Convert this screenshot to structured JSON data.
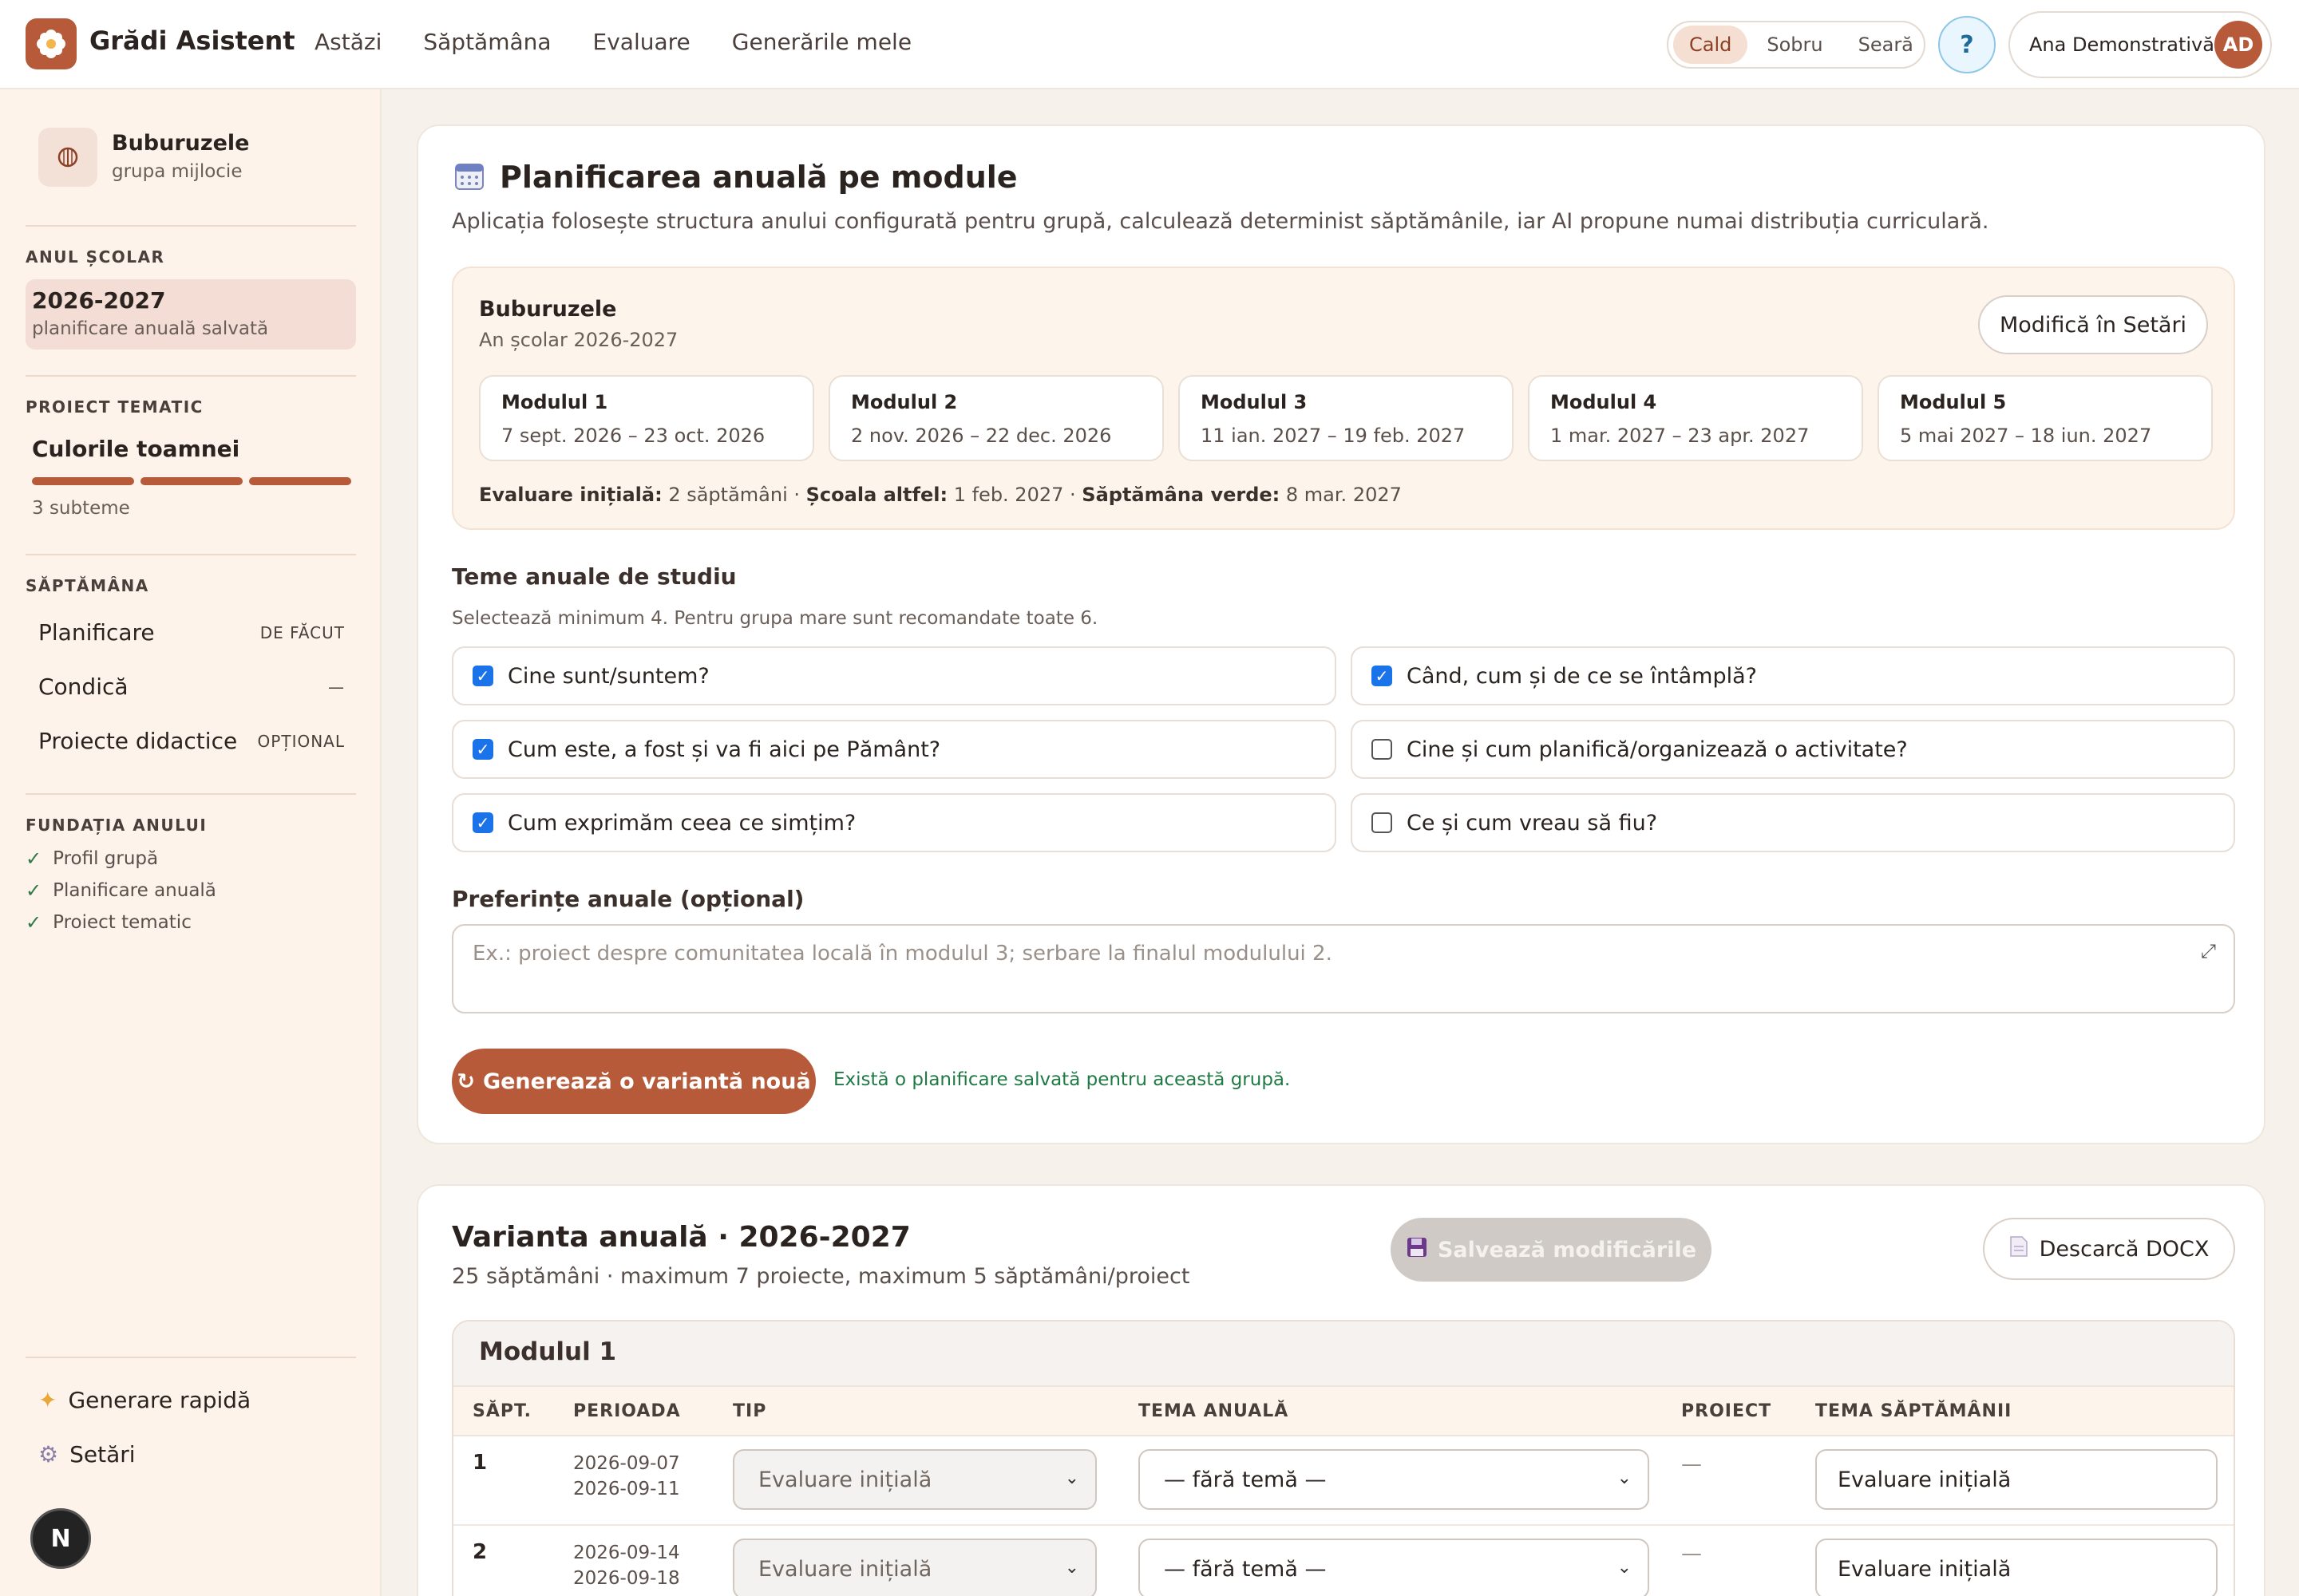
{
  "app": {
    "title": "Grădi Asistent",
    "nav": [
      "Astăzi",
      "Săptămâna",
      "Evaluare",
      "Generările mele"
    ],
    "theme_options": [
      "Cald",
      "Sobru",
      "Seară"
    ],
    "active_theme": "Cald",
    "help_label": "?",
    "user_name": "Ana Demonstrativă",
    "user_initials": "AD",
    "accent_color": "#b65a3a"
  },
  "sidebar": {
    "group_name": "Buburuzele",
    "group_sub": "grupa mijlocie",
    "year_head": "ANUL ȘCOLAR",
    "year_value": "2026-2027",
    "year_sub": "planificare anuală salvată",
    "project_head": "PROIECT TEMATIC",
    "project_title": "Culorile toamnei",
    "project_sub": "3 subteme",
    "week_head": "SĂPTĂMÂNA",
    "week_items": [
      {
        "label": "Planificare",
        "status": "DE FĂCUT"
      },
      {
        "label": "Condică",
        "status": "—"
      },
      {
        "label": "Proiecte didactice",
        "status": "OPȚIONAL"
      }
    ],
    "foundation_head": "FUNDAȚIA ANULUI",
    "foundation_items": [
      "Profil grupă",
      "Planificare anuală",
      "Proiect tematic"
    ],
    "bottom_items": [
      "Generare rapidă",
      "Setări"
    ],
    "badge": "N"
  },
  "planning": {
    "title": "Planificarea anuală pe module",
    "description": "Aplicația folosește structura anului configurată pentru grupă, calculează determinist săptămânile, iar AI propune numai distribuția curriculară.",
    "group_name": "Buburuzele",
    "school_year": "An școlar 2026-2027",
    "modify_button": "Modifică în Setări",
    "modules": [
      {
        "name": "Modulul 1",
        "range": "7 sept. 2026 – 23 oct. 2026"
      },
      {
        "name": "Modulul 2",
        "range": "2 nov. 2026 – 22 dec. 2026"
      },
      {
        "name": "Modulul 3",
        "range": "11 ian. 2027 – 19 feb. 2027"
      },
      {
        "name": "Modulul 4",
        "range": "1 mar. 2027 – 23 apr. 2027"
      },
      {
        "name": "Modulul 5",
        "range": "5 mai 2027 – 18 iun. 2027"
      }
    ],
    "footer": {
      "eval_label": "Evaluare inițială:",
      "eval_value": "2 săptămâni",
      "scoala_label": "Școala altfel:",
      "scoala_value": "1 feb. 2027",
      "verde_label": "Săptămâna verde:",
      "verde_value": "8 mar. 2027"
    },
    "themes_title": "Teme anuale de studiu",
    "themes_sub": "Selectează minimum 4. Pentru grupa mare sunt recomandate toate 6.",
    "themes": [
      {
        "label": "Cine sunt/suntem?",
        "checked": true
      },
      {
        "label": "Când, cum și de ce se întâmplă?",
        "checked": true
      },
      {
        "label": "Cum este, a fost și va fi aici pe Pământ?",
        "checked": true
      },
      {
        "label": "Cine și cum planifică/organizează o activitate?",
        "checked": false
      },
      {
        "label": "Cum exprimăm ceea ce simțim?",
        "checked": true
      },
      {
        "label": "Ce și cum vreau să fiu?",
        "checked": false
      }
    ],
    "prefs_title": "Preferințe anuale (opțional)",
    "prefs_placeholder": "Ex.: proiect despre comunitatea locală în modulul 3; serbare la finalul modulului 2.",
    "generate_button": "Generează o variantă nouă",
    "saved_note": "Există o planificare salvată pentru această grupă."
  },
  "variant": {
    "title": "Varianta anuală · 2026-2027",
    "subtitle": "25 săptămâni · maximum 7 proiecte, maximum 5 săptămâni/proiect",
    "save_button": "Salvează modificările",
    "docx_button": "Descarcă DOCX",
    "module_title": "Modulul 1",
    "columns": [
      "SĂPT.",
      "PERIOADA",
      "TIP",
      "TEMA ANUALĂ",
      "PROIECT",
      "TEMA SĂPTĂMÂNII"
    ],
    "rows": [
      {
        "week": "1",
        "start": "2026-09-07",
        "end": "2026-09-11",
        "type": "Evaluare inițială",
        "theme": "— fără temă —",
        "project": "—",
        "week_theme": "Evaluare inițială"
      },
      {
        "week": "2",
        "start": "2026-09-14",
        "end": "2026-09-18",
        "type": "Evaluare inițială",
        "theme": "— fără temă —",
        "project": "—",
        "week_theme": "Evaluare inițială"
      }
    ]
  }
}
